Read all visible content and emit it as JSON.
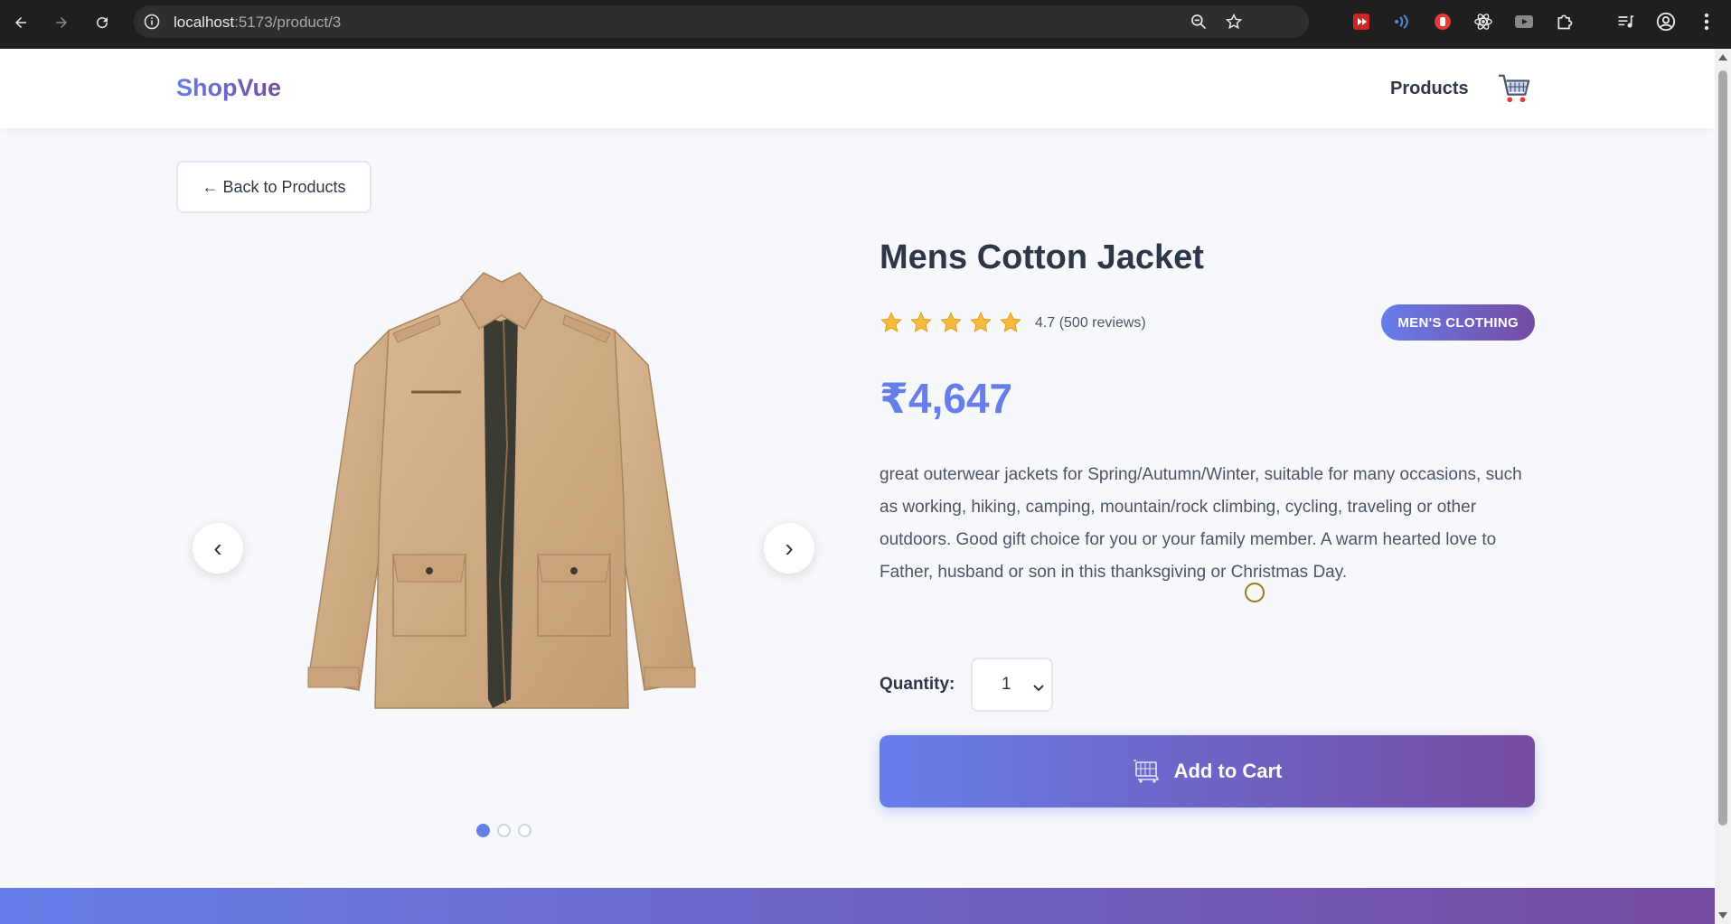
{
  "browser": {
    "url_host": "localhost",
    "url_path": ":5173/product/3"
  },
  "header": {
    "logo": "ShopVue",
    "nav_products": "Products"
  },
  "back_button": "← Back to Products",
  "gallery": {
    "prev_arrow": "‹",
    "next_arrow": "›",
    "slide_count": 3,
    "active_slide": 1
  },
  "product": {
    "title": "Mens Cotton Jacket",
    "rating_value": 4.7,
    "rating_text": "4.7 (500 reviews)",
    "category": "MEN'S CLOTHING",
    "price": "₹4,647",
    "description": "great outerwear jackets for Spring/Autumn/Winter, suitable for many occasions, such as working, hiking, camping, mountain/rock climbing, cycling, traveling or other outdoors. Good gift choice for you or your family member. A warm hearted love to Father, husband or son in this thanksgiving or Christmas Day."
  },
  "quantity": {
    "label": "Quantity:",
    "value": "1"
  },
  "add_to_cart": "Add to Cart",
  "colors": {
    "accent_start": "#667eea",
    "accent_end": "#764ba2",
    "star": "#f6b93b"
  }
}
